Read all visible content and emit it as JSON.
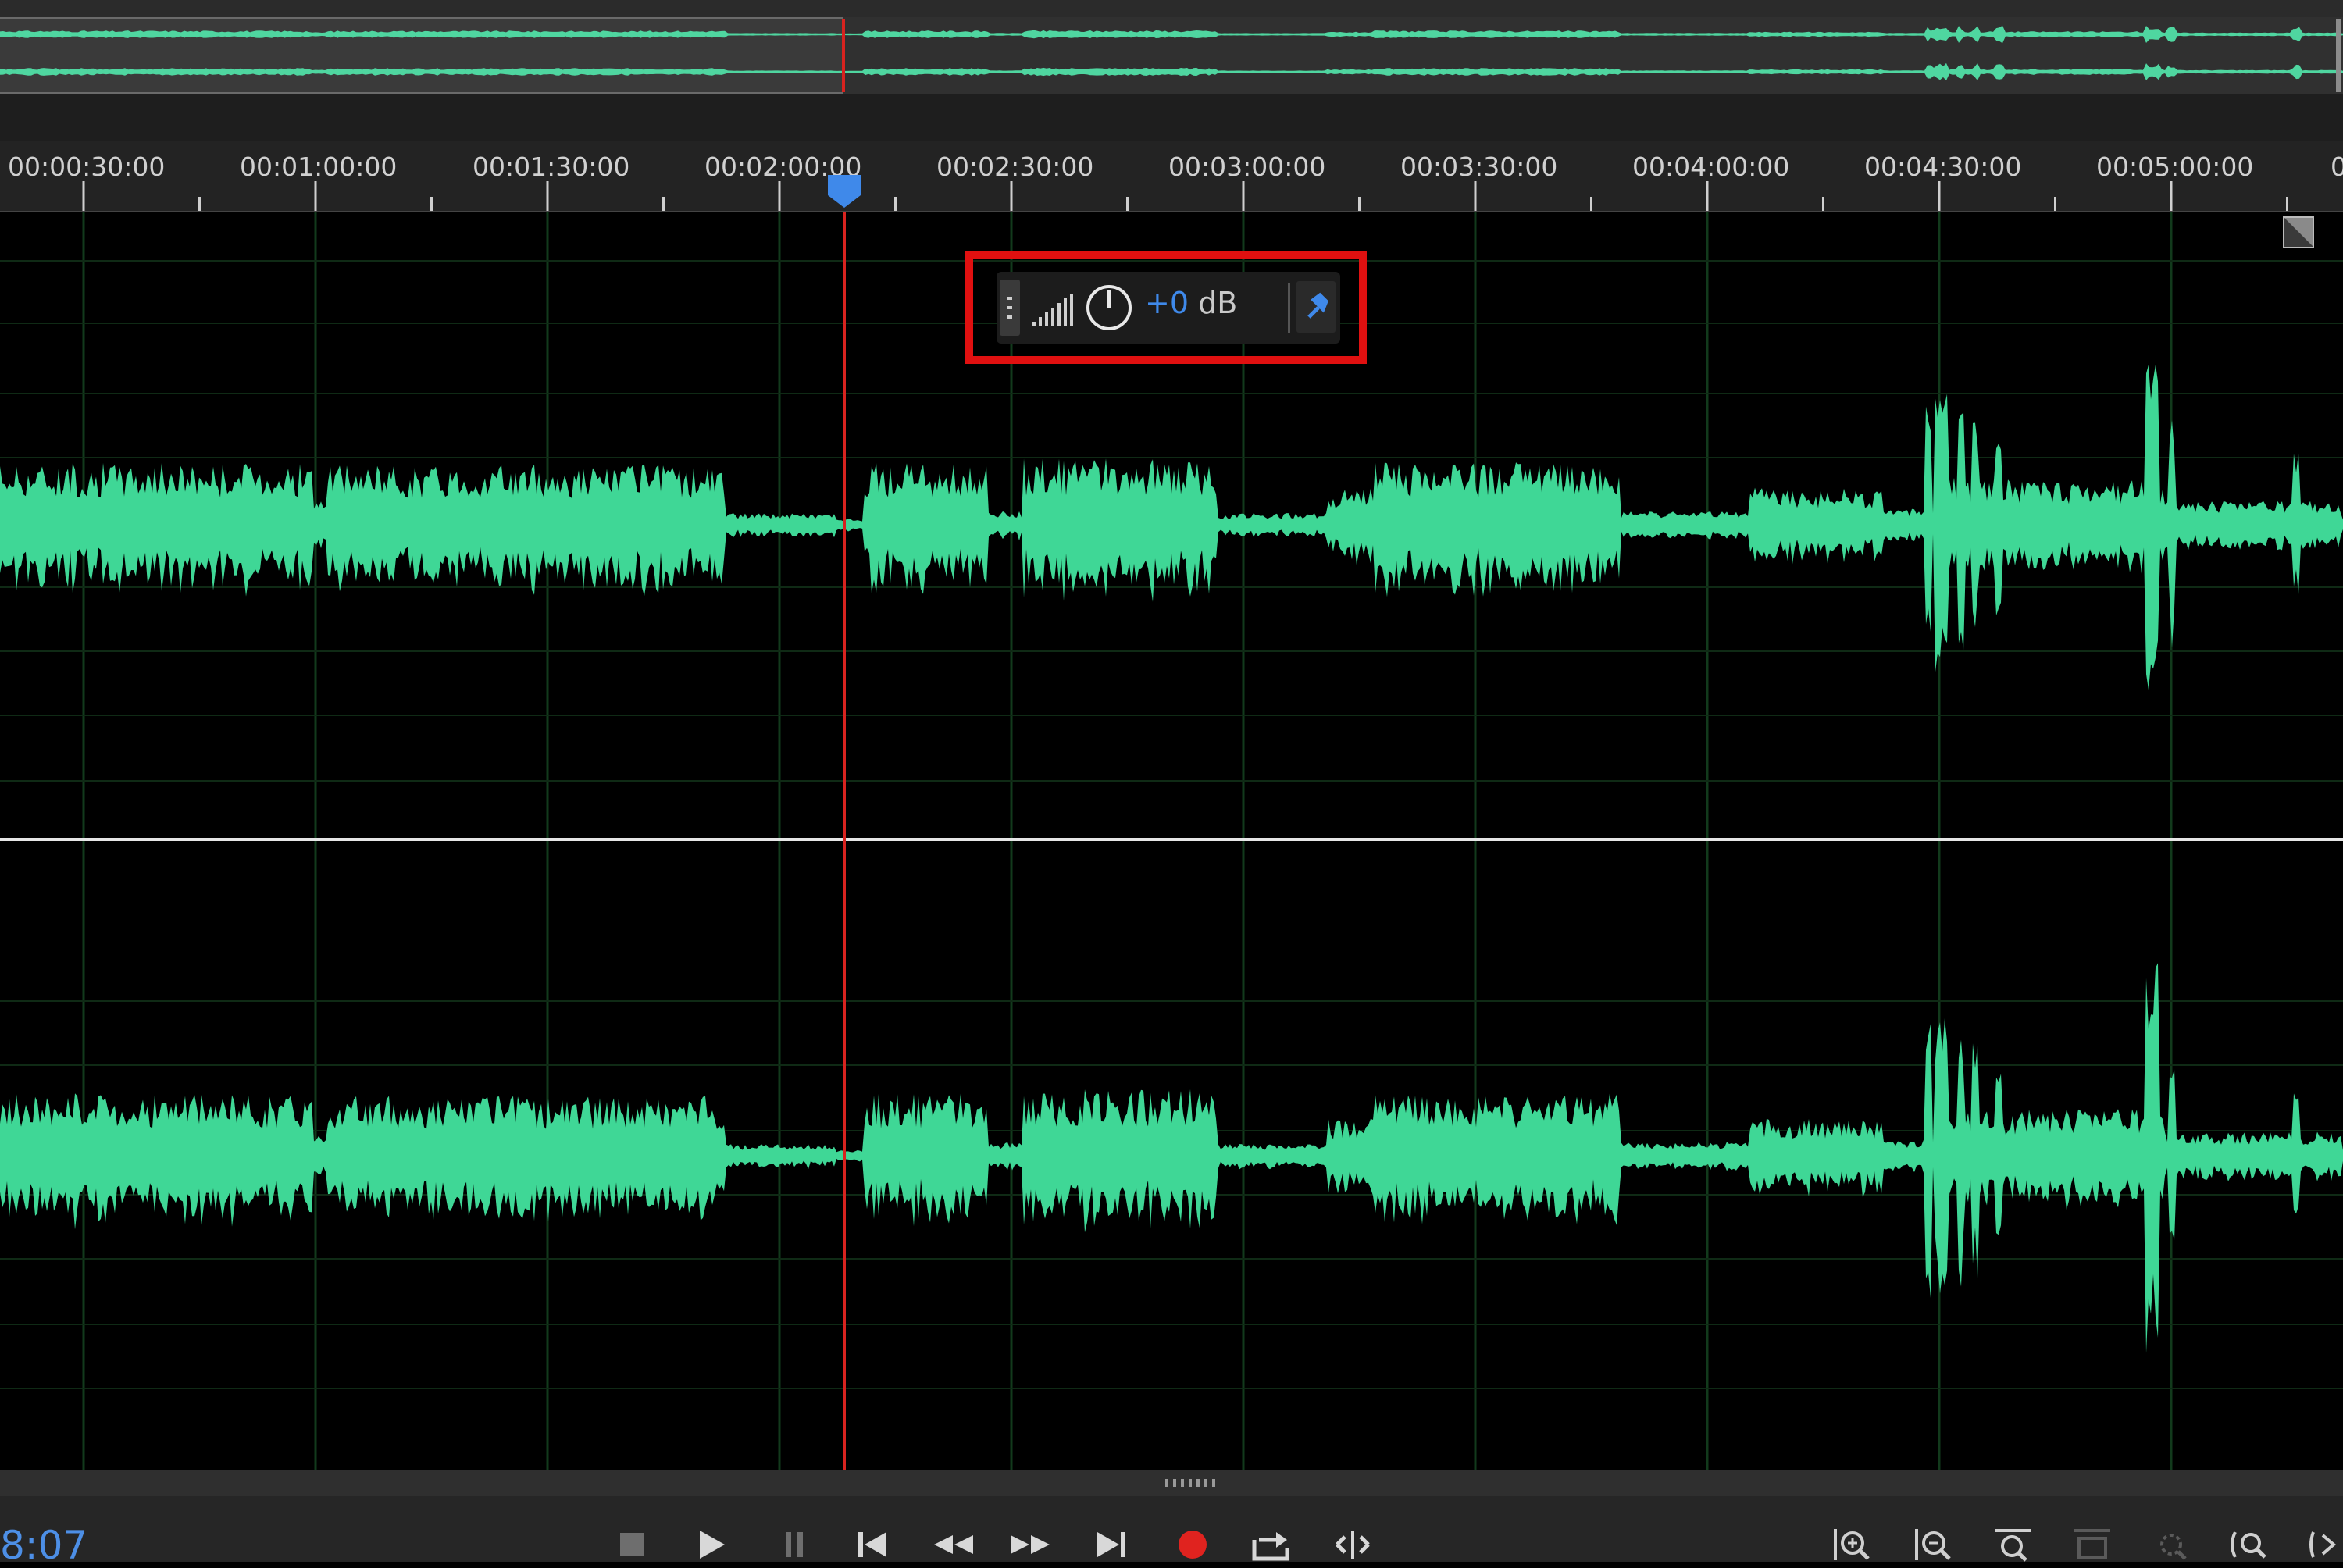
{
  "colors": {
    "waveform": "#3fd796",
    "playhead": "#d8231f",
    "cti_marker": "#3f89ea",
    "highlight_box": "#e01010",
    "time_text": "#4d8fe6",
    "record": "#e0231f"
  },
  "ruler": {
    "labels": [
      "00:00:30:00",
      "00:01:00:00",
      "00:01:30:00",
      "00:02:00:00",
      "00:02:30:00",
      "00:03:00:00",
      "00:03:30:00",
      "00:04:00:00",
      "00:04:30:00",
      "00:05:00:00",
      "0"
    ]
  },
  "hud": {
    "gain_value": "+0",
    "gain_unit": "dB",
    "icons": [
      "grip-icon",
      "level-meter-icon",
      "gain-knob-icon",
      "pin-icon"
    ]
  },
  "transport": {
    "time": "8:07",
    "buttons": [
      {
        "name": "stop-button",
        "icon": "stop-icon"
      },
      {
        "name": "play-button",
        "icon": "play-icon"
      },
      {
        "name": "pause-button",
        "icon": "pause-icon"
      },
      {
        "name": "go-to-start-button",
        "icon": "skip-back-icon"
      },
      {
        "name": "rewind-button",
        "icon": "rewind-icon"
      },
      {
        "name": "fast-forward-button",
        "icon": "fast-forward-icon"
      },
      {
        "name": "go-to-end-button",
        "icon": "skip-forward-icon"
      },
      {
        "name": "record-button",
        "icon": "record-icon"
      },
      {
        "name": "loop-button",
        "icon": "loop-icon"
      },
      {
        "name": "skip-selection-button",
        "icon": "skip-selection-icon"
      }
    ],
    "zoom_buttons": [
      {
        "name": "zoom-in-amplitude-button",
        "icon": "zoom-in-amplitude-icon"
      },
      {
        "name": "zoom-out-amplitude-button",
        "icon": "zoom-out-amplitude-icon"
      },
      {
        "name": "zoom-in-time-button",
        "icon": "zoom-in-time-icon"
      },
      {
        "name": "zoom-out-full-button",
        "icon": "zoom-out-full-icon"
      },
      {
        "name": "zoom-selection-button",
        "icon": "zoom-selection-icon"
      },
      {
        "name": "zoom-in-point-button",
        "icon": "zoom-in-point-icon"
      }
    ]
  }
}
